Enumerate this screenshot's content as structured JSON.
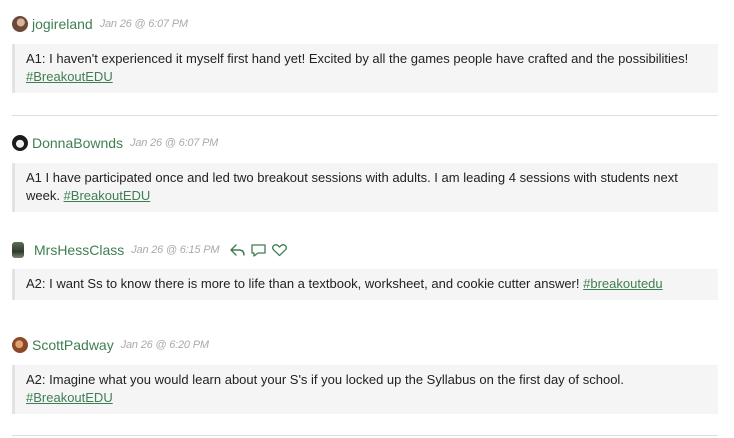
{
  "posts": [
    {
      "username": "jogireland",
      "time": "Jan 26 @ 6:07 PM",
      "text": "A1: I haven't experienced it myself first hand yet! Excited by all the games people have crafted and the possibilities! ",
      "hashtag": "#BreakoutEDU"
    },
    {
      "username": "DonnaBownds",
      "time": "Jan 26 @ 6:07 PM",
      "text": "A1 I have participated once and led two breakout sessions with adults. I am leading 4 sessions with students next week. ",
      "hashtag": "#BreakoutEDU"
    },
    {
      "username": "MrsHessClass",
      "time": "Jan 26 @ 6:15 PM",
      "text": "A2: I want Ss to know there is more to life than a textbook, worksheet, and cookie cutter answer! ",
      "hashtag": "#breakoutedu",
      "actions": [
        "reply-icon",
        "quote-icon",
        "heart-icon"
      ]
    },
    {
      "username": "ScottPadway",
      "time": "Jan 26 @ 6:20 PM",
      "text": "A2: Imagine what you would learn about your S's if you locked up the Syllabus on the first day of school. ",
      "hashtag": "#BreakoutEDU"
    }
  ],
  "colors": {
    "username": "#3f7e52",
    "hashtag": "#3f7e52",
    "timestamp": "#aaaaaa",
    "body_bg": "#f5f5f5",
    "body_border": "#e3e3e3"
  }
}
